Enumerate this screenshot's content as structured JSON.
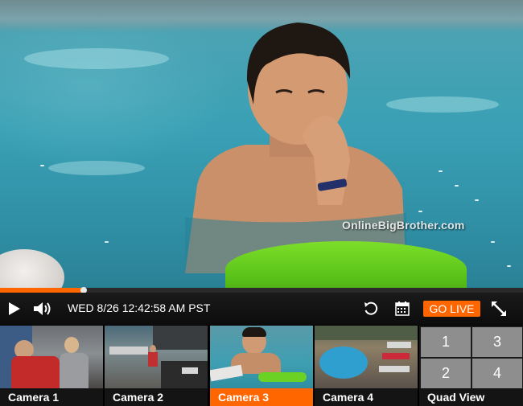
{
  "video": {
    "watermark": "OnlineBigBrother.com"
  },
  "player": {
    "progress": 0.16,
    "timestamp": "WED 8/26 12:42:58 AM PST",
    "go_live_label": "GO LIVE",
    "icons": [
      "play-icon",
      "volume-icon",
      "rewind-icon",
      "calendar-icon",
      "fullscreen-icon"
    ]
  },
  "cameras": [
    {
      "label": "Camera 1",
      "active": false
    },
    {
      "label": "Camera 2",
      "active": false
    },
    {
      "label": "Camera 3",
      "active": true
    },
    {
      "label": "Camera 4",
      "active": false
    },
    {
      "label": "Quad View",
      "active": false,
      "cells": [
        "1",
        "3",
        "2",
        "4"
      ]
    }
  ],
  "colors": {
    "accent": "#ff6600",
    "control_bar": "#111111",
    "quad_cell": "#8e8e8e"
  }
}
